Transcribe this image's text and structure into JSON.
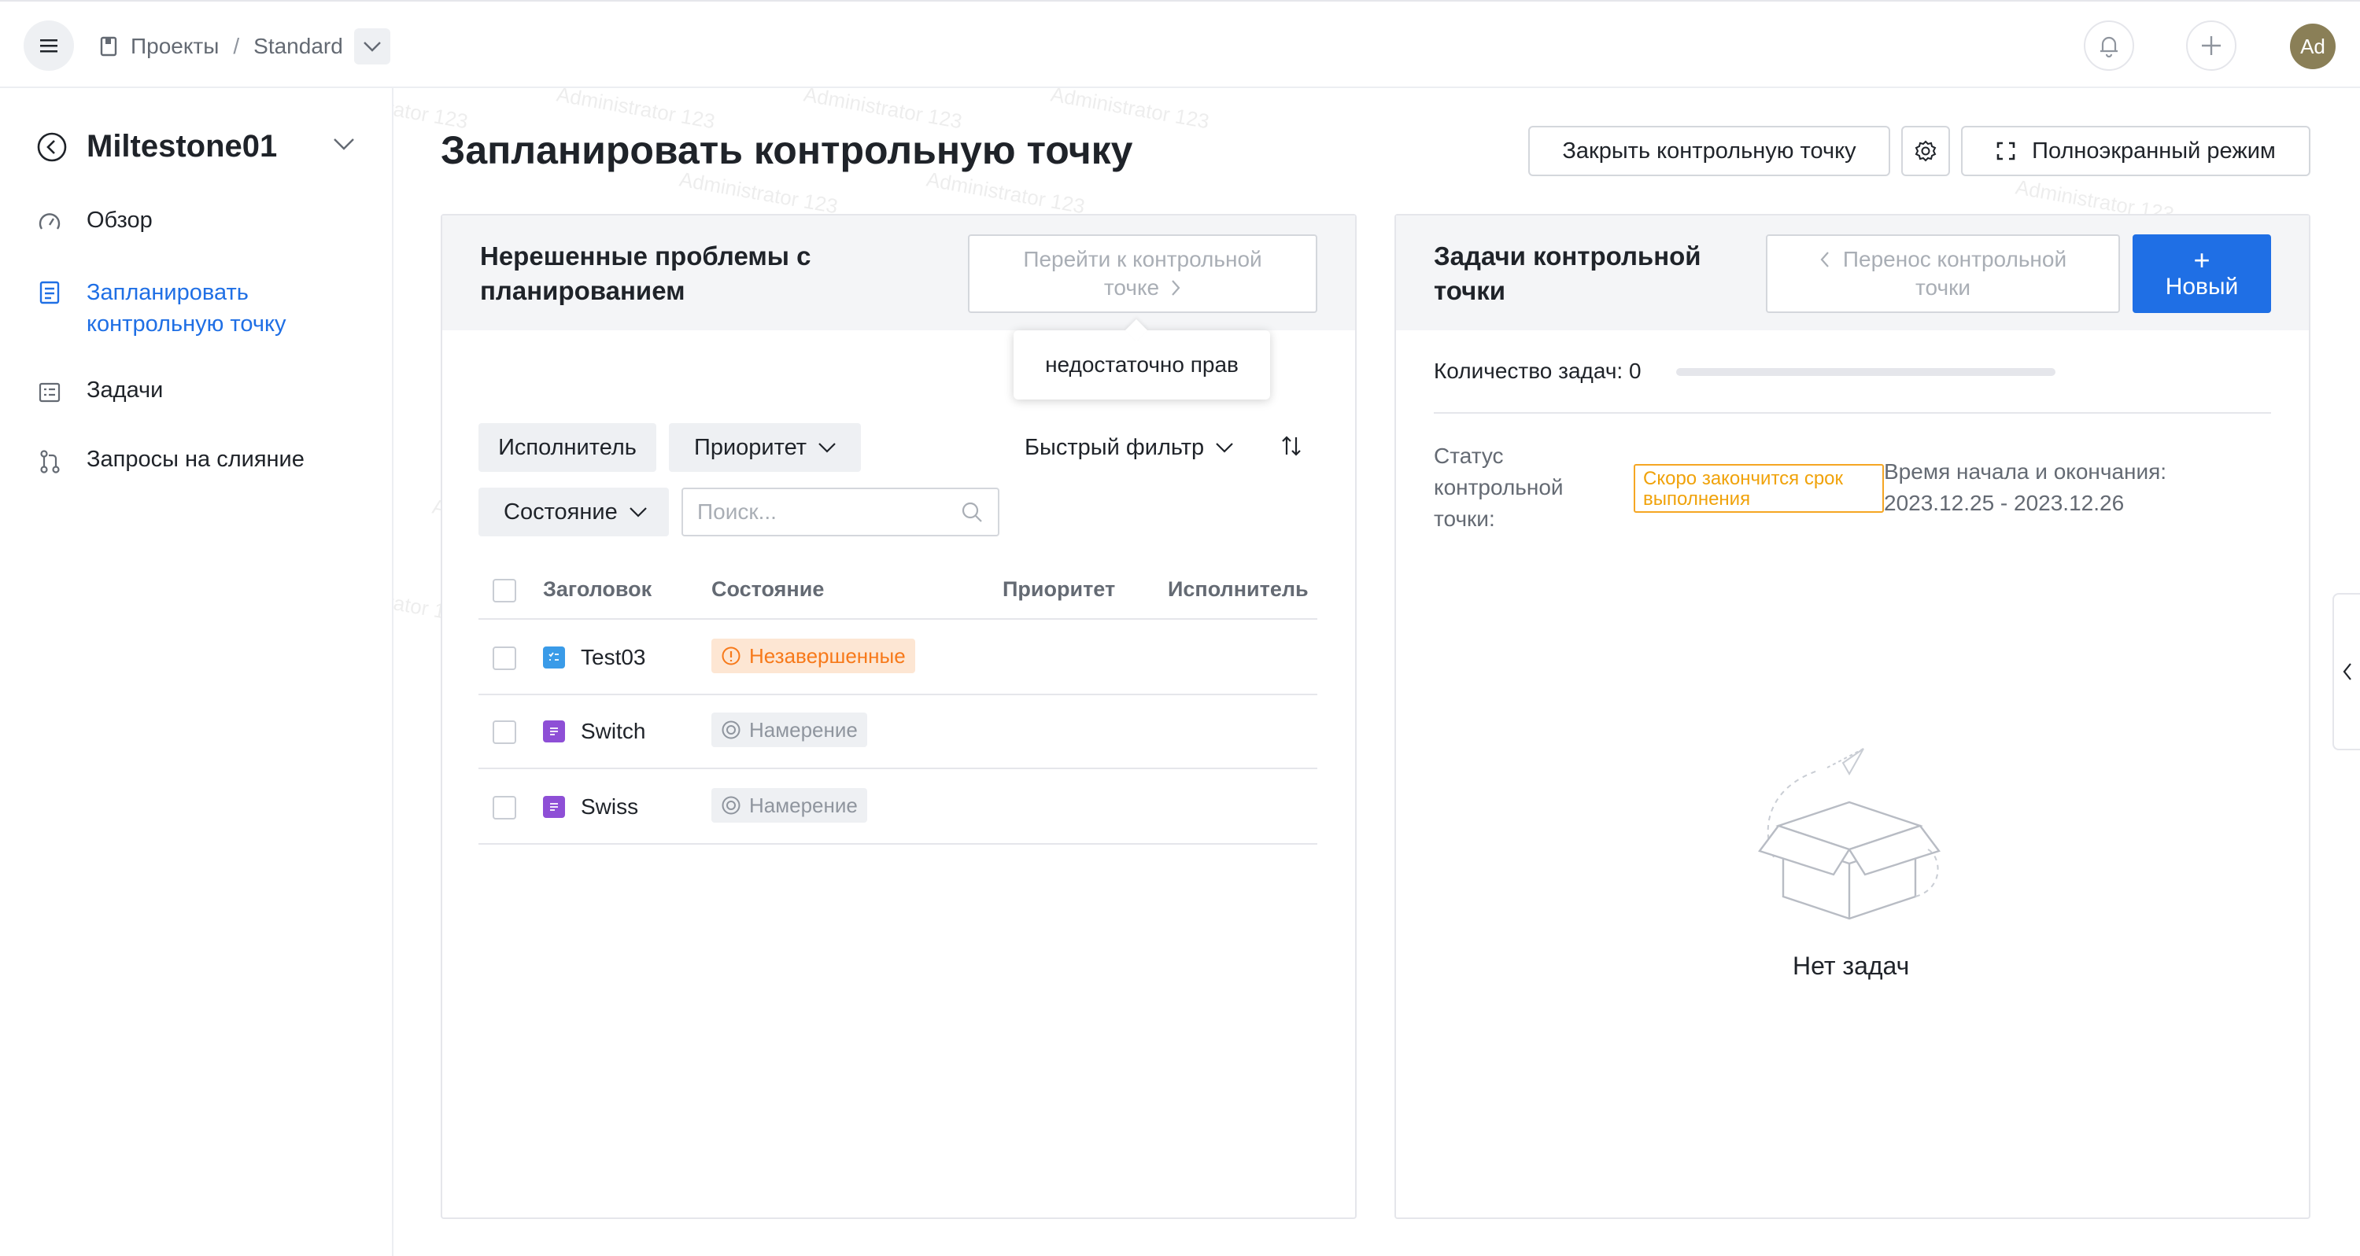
{
  "topbar": {
    "breadcrumb_projects": "Проекты",
    "breadcrumb_sep": "/",
    "breadcrumb_current": "Standard",
    "avatar_initials": "Ad"
  },
  "sidebar": {
    "milestone_title": "Miltestone01",
    "items": [
      {
        "label": "Обзор",
        "icon": "gauge-icon",
        "active": false
      },
      {
        "label_line1": "Запланировать",
        "label_line2": "контрольную точку",
        "icon": "plan-clipboard-icon",
        "active": true
      },
      {
        "label": "Задачи",
        "icon": "tasks-list-icon",
        "active": false
      },
      {
        "label": "Запросы на слияние",
        "icon": "merge-request-icon",
        "active": false
      }
    ]
  },
  "main": {
    "title": "Запланировать контрольную точку",
    "close_milestone_label": "Закрыть контрольную точку",
    "fullscreen_label": "Полноэкранный режим"
  },
  "left_panel": {
    "title_line1": "Нерешенные проблемы с",
    "title_line2": "планированием",
    "goto_line1": "Перейти к контрольной",
    "goto_line2": "точке",
    "tooltip": "недостаточно прав",
    "filters": {
      "assignee": "Исполнитель",
      "priority": "Приоритет",
      "quick_filter": "Быстрый фильтр",
      "state": "Состояние",
      "search_placeholder": "Поиск..."
    },
    "table": {
      "headers": {
        "title": "Заголовок",
        "state": "Состояние",
        "priority": "Приоритет",
        "assignee": "Исполнитель"
      },
      "rows": [
        {
          "title": "Test03",
          "state": "Незавершенные",
          "type": "task",
          "state_color": "#f7791a"
        },
        {
          "title": "Switch",
          "state": "Намерение",
          "type": "requirement",
          "state_color": "#8f959e"
        },
        {
          "title": "Swiss",
          "state": "Намерение",
          "type": "requirement",
          "state_color": "#8f959e"
        }
      ]
    }
  },
  "right_panel": {
    "title_line1": "Задачи контрольной",
    "title_line2": "точки",
    "transfer_line1": "Перенос контрольной",
    "transfer_line2": "точки",
    "new_plus": "+",
    "new_label": "Новый",
    "task_count": "Количество задач: 0",
    "progress_fraction": 0,
    "status_label_line1": "Статус",
    "status_label_line2": "контрольной",
    "status_label_line3": "точки:",
    "status_value_line1": "Скоро закончится срок",
    "status_value_line2": "выполнения",
    "time_label": "Время начала и окончания:",
    "time_value": "2023.12.25  -  2023.12.26",
    "empty_text": "Нет задач"
  },
  "watermark_text": "Administrator 123",
  "colors": {
    "accent": "#1f6fe5",
    "warning": "#f0a20a",
    "in_progress": "#f7791a",
    "requirement_icon": "#8e4fd6",
    "task_icon": "#3a9be8"
  }
}
